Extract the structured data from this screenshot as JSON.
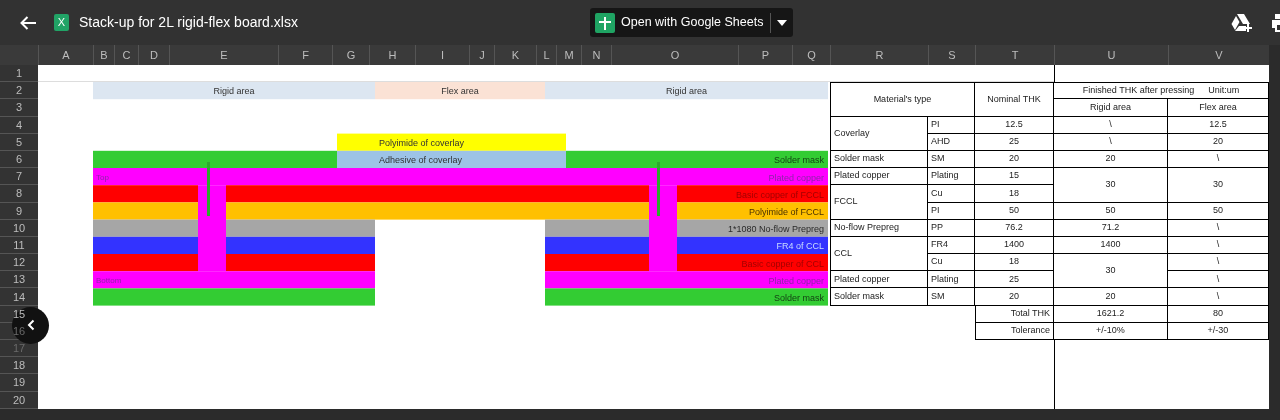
{
  "top_bar": {
    "file_badge": "X",
    "file_name": "Stack-up for 2L rigid-flex board.xlsx",
    "open_button": "Open with Google Sheets"
  },
  "columns": [
    "A",
    "B",
    "C",
    "D",
    "E",
    "F",
    "G",
    "H",
    "I",
    "J",
    "K",
    "L",
    "M",
    "N",
    "O",
    "P",
    "Q",
    "R",
    "S",
    "T",
    "U",
    "V"
  ],
  "rows": [
    "1",
    "2",
    "3",
    "4",
    "5",
    "6",
    "7",
    "8",
    "9",
    "10",
    "11",
    "12",
    "13",
    "14",
    "15",
    "16",
    "17",
    "18",
    "19",
    "20"
  ],
  "cross_section": {
    "zones": [
      {
        "label": "Rigid area",
        "kind": "rigid"
      },
      {
        "label": "Flex area",
        "kind": "flex"
      },
      {
        "label": "Rigid area",
        "kind": "rigid"
      }
    ],
    "layers": [
      {
        "kind": "coverlay_pi",
        "label": "Polyimide of coverlay",
        "color": "#ffff00"
      },
      {
        "kind": "coverlay_adhesive",
        "label": "Adhesive of coverlay",
        "color": "#9dc3e6"
      },
      {
        "kind": "top_mask",
        "label": "Solder mask",
        "color": "#33cc33"
      },
      {
        "kind": "top_plating",
        "label": "Plated copper",
        "side_label": "Top",
        "color": "#ff00ff"
      },
      {
        "kind": "fccl_copper",
        "label": "Basic copper of FCCL",
        "color": "#ff0000"
      },
      {
        "kind": "fccl_pi",
        "label": "Polyimide of FCCL",
        "color": "#ffc000"
      },
      {
        "kind": "prepreg",
        "label": "1*1080 No-flow Prepreg",
        "color": "#a6a6a6"
      },
      {
        "kind": "ccl_fr4",
        "label": "FR4 of CCL",
        "color": "#3333ff"
      },
      {
        "kind": "ccl_copper",
        "label": "Basic copper of CCL",
        "color": "#ff0000"
      },
      {
        "kind": "bottom_plating",
        "label": "Plated copper",
        "side_label": "Bottom",
        "color": "#ff00ff"
      },
      {
        "kind": "bottom_mask",
        "label": "Solder mask",
        "color": "#33cc33"
      }
    ]
  },
  "table_cells": [
    {
      "text": "Material's type"
    },
    {
      "text": "Nominal THK"
    },
    {
      "text": "Finished THK after pressing",
      "note": "Unit:um"
    },
    {
      "text": "Rigid area"
    },
    {
      "text": "Flex area"
    },
    {
      "text": "Coverlay"
    },
    {
      "text": "PI"
    },
    {
      "text": "12.5"
    },
    {
      "text": "\\"
    },
    {
      "text": "12.5"
    },
    {
      "text": "AHD"
    },
    {
      "text": "25"
    },
    {
      "text": "\\"
    },
    {
      "text": "20"
    },
    {
      "text": "Solder mask"
    },
    {
      "text": "SM"
    },
    {
      "text": "20"
    },
    {
      "text": "20"
    },
    {
      "text": "\\"
    },
    {
      "text": "Plated copper"
    },
    {
      "text": "Plating"
    },
    {
      "text": "15"
    },
    {
      "text": "30"
    },
    {
      "text": "30"
    },
    {
      "text": "FCCL"
    },
    {
      "text": "Cu"
    },
    {
      "text": "18"
    },
    {
      "text": "PI"
    },
    {
      "text": "50"
    },
    {
      "text": "50"
    },
    {
      "text": "50"
    },
    {
      "text": "No-flow Prepreg"
    },
    {
      "text": "PP"
    },
    {
      "text": "76.2"
    },
    {
      "text": "71.2"
    },
    {
      "text": "\\"
    },
    {
      "text": "CCL"
    },
    {
      "text": "FR4"
    },
    {
      "text": "1400"
    },
    {
      "text": "1400"
    },
    {
      "text": "\\"
    },
    {
      "text": "Cu"
    },
    {
      "text": "18"
    },
    {
      "text": "30"
    },
    {
      "text": "\\"
    },
    {
      "text": "Plated copper"
    },
    {
      "text": "Plating"
    },
    {
      "text": "25"
    },
    {
      "text": "\\"
    },
    {
      "text": "Solder mask"
    },
    {
      "text": "SM"
    },
    {
      "text": "20"
    },
    {
      "text": "20"
    },
    {
      "text": "\\"
    },
    {
      "text": "Total THK"
    },
    {
      "text": "1621.2"
    },
    {
      "text": "80"
    },
    {
      "text": "Tolerance"
    },
    {
      "text": "+/-10%"
    },
    {
      "text": "+/-30"
    }
  ]
}
